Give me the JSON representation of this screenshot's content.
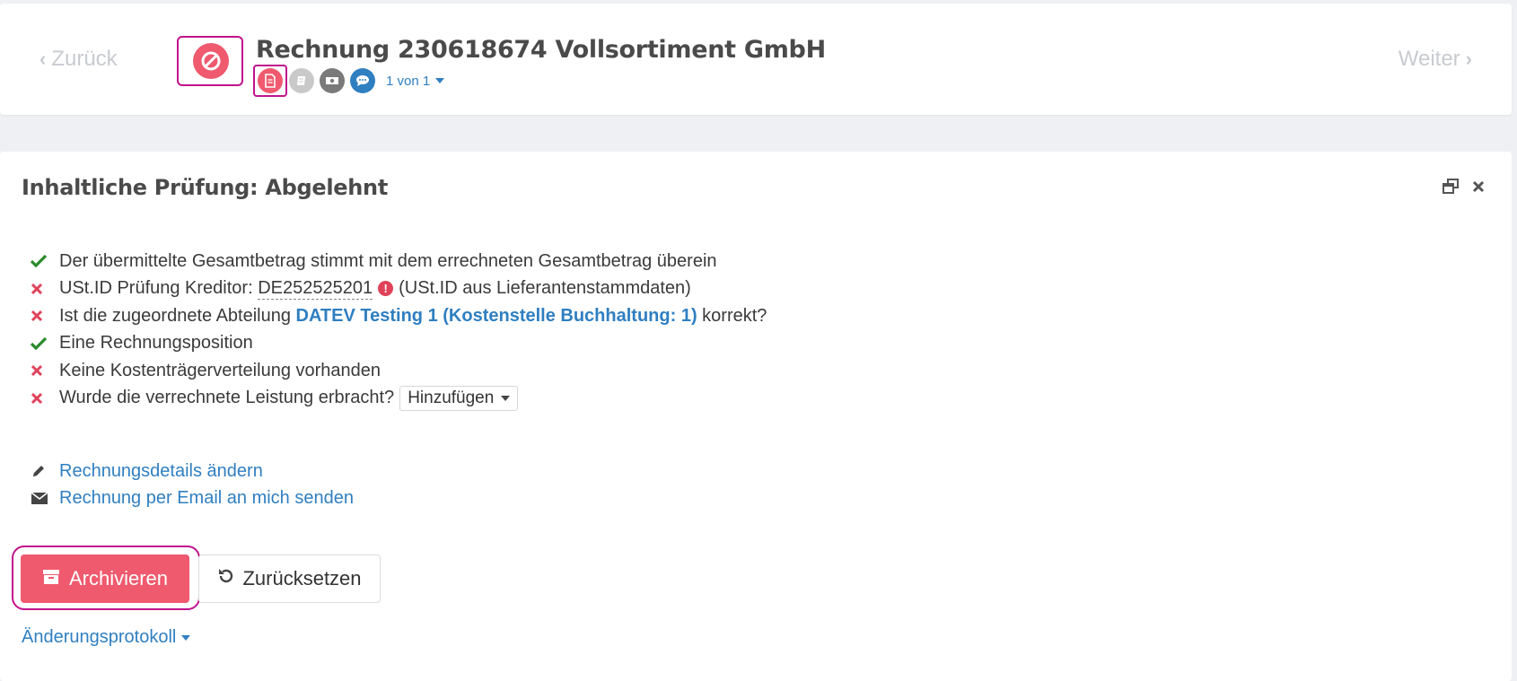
{
  "header": {
    "back_label": "Zurück",
    "next_label": "Weiter",
    "title": "Rechnung 230618674 Vollsortiment GmbH",
    "page_selector": "1 von 1"
  },
  "panel": {
    "title": "Inhaltliche Prüfung: Abgelehnt",
    "checks": [
      {
        "status": "ok",
        "text": "Der übermittelte Gesamtbetrag stimmt mit dem errechneten Gesamtbetrag überein"
      },
      {
        "status": "fail",
        "prefix": "USt.ID Prüfung Kreditor:",
        "vat_id": "DE252525201",
        "suffix": "(USt.ID aus Lieferantenstammdaten)"
      },
      {
        "status": "fail",
        "prefix": "Ist die zugeordnete Abteilung",
        "department": "DATEV Testing 1 (Kostenstelle Buchhaltung: 1)",
        "suffix": "korrekt?"
      },
      {
        "status": "ok",
        "text": "Eine Rechnungsposition"
      },
      {
        "status": "fail",
        "text": "Keine Kostenträgerverteilung vorhanden"
      },
      {
        "status": "fail",
        "text": "Wurde die verrechnete Leistung erbracht?",
        "dropdown": "Hinzufügen"
      }
    ],
    "links": {
      "edit_details": "Rechnungsdetails ändern",
      "send_email": "Rechnung per Email an mich senden"
    },
    "buttons": {
      "archive": "Archivieren",
      "reset": "Zurücksetzen"
    },
    "changelog": "Änderungsprotokoll"
  },
  "colors": {
    "accent_red": "#ef5a6e",
    "link_blue": "#2f7fc1",
    "ok_green": "#2a8a2a",
    "highlight_magenta": "#c0138c"
  }
}
